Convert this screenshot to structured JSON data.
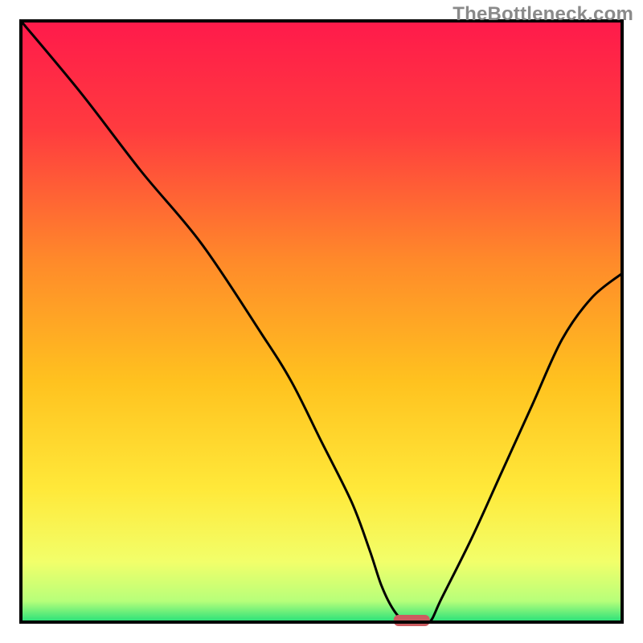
{
  "watermark": "TheBottleneck.com",
  "chart_data": {
    "type": "line",
    "title": "",
    "xlabel": "",
    "ylabel": "",
    "xlim": [
      0,
      100
    ],
    "ylim": [
      0,
      100
    ],
    "legend": false,
    "grid": false,
    "background": "vertical gradient red→orange→yellow→green",
    "frame": true,
    "series": [
      {
        "name": "bottleneck-curve",
        "color": "#000000",
        "x": [
          0,
          10,
          20,
          30,
          40,
          45,
          50,
          55,
          58,
          60,
          62,
          64,
          66,
          68,
          70,
          75,
          80,
          85,
          90,
          95,
          100
        ],
        "y": [
          100,
          88,
          75,
          63,
          48,
          40,
          30,
          20,
          12,
          6,
          2,
          0,
          0,
          0,
          4,
          14,
          25,
          36,
          47,
          54,
          58
        ]
      }
    ],
    "markers": [
      {
        "name": "optimal-marker",
        "shape": "rounded-bar",
        "x_center": 65,
        "y": 0,
        "color": "#cc5b60",
        "width_x_units": 6
      }
    ],
    "gradient_stops": [
      {
        "offset": 0.0,
        "color": "#ff1a4b"
      },
      {
        "offset": 0.18,
        "color": "#ff3b3f"
      },
      {
        "offset": 0.4,
        "color": "#ff8a2a"
      },
      {
        "offset": 0.6,
        "color": "#ffc21f"
      },
      {
        "offset": 0.78,
        "color": "#ffe93a"
      },
      {
        "offset": 0.9,
        "color": "#f2ff6a"
      },
      {
        "offset": 0.965,
        "color": "#b7ff7a"
      },
      {
        "offset": 1.0,
        "color": "#25e07a"
      }
    ]
  }
}
